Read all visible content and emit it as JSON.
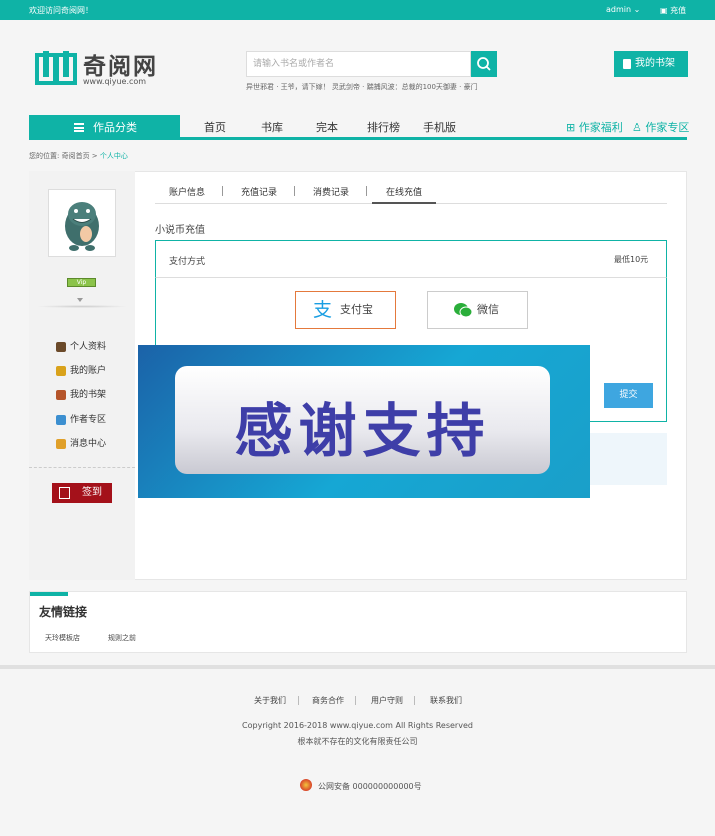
{
  "topbar": {
    "welcome": "欢迎访问奇阅网！",
    "user": "admin",
    "charge": "充值"
  },
  "logo": {
    "text": "奇阅网",
    "url": "www.qiyue.com"
  },
  "search": {
    "placeholder": "请输入书名或作者名",
    "hot": "异世邪君 · 王爷，请下嫁！ 灵武剑帝 · 踹捕风波：总裁的100天御妻 · 豪门"
  },
  "shelf_button": "我的书架",
  "nav": {
    "category": "作品分类",
    "items": [
      "首页",
      "书库",
      "完本",
      "排行榜",
      "手机版"
    ],
    "writer_welfare": "作家福利",
    "writer_zone": "作家专区"
  },
  "breadcrumb": {
    "prefix": "您的位置: 奇阅首页 >",
    "current": "个人中心"
  },
  "sidebar": {
    "badge": "Vip",
    "items": [
      "个人资料",
      "我的账户",
      "我的书架",
      "作者专区",
      "消息中心"
    ],
    "sign": "签到"
  },
  "tabs": [
    "账户信息",
    "充值记录",
    "消费记录",
    "在线充值"
  ],
  "recharge": {
    "title": "小说币充值",
    "method_label": "支付方式",
    "min_note": "最低10元",
    "alipay": "支付宝",
    "wechat": "微信",
    "submit": "提交"
  },
  "overlay": {
    "text": "感谢支持"
  },
  "friend_links": {
    "title": "友情链接",
    "items": [
      "天玲模板店",
      "规则之前"
    ]
  },
  "footer": {
    "links": [
      "关于我们",
      "商务合作",
      "用户守则",
      "联系我们"
    ],
    "copyright": "Copyright 2016-2018 www.qiyue.com All Rights Reserved",
    "company": "根本就不存在的文化有限责任公司",
    "police": "公网安备 000000000000号"
  },
  "colors": {
    "brand": "#0fb3a6",
    "sign": "#a4111a",
    "submit": "#3ea6e0"
  }
}
